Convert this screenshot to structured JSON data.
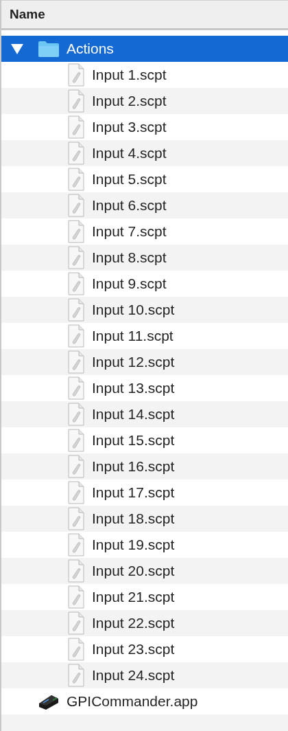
{
  "header": {
    "label": "Name"
  },
  "tree": [
    {
      "name": "Actions",
      "kind": "folder",
      "expanded": true,
      "selected": true,
      "children": [
        {
          "name": "Input 1.scpt",
          "kind": "script",
          "selected": false
        },
        {
          "name": "Input 2.scpt",
          "kind": "script",
          "selected": false
        },
        {
          "name": "Input 3.scpt",
          "kind": "script",
          "selected": false
        },
        {
          "name": "Input 4.scpt",
          "kind": "script",
          "selected": false
        },
        {
          "name": "Input 5.scpt",
          "kind": "script",
          "selected": false
        },
        {
          "name": "Input 6.scpt",
          "kind": "script",
          "selected": false
        },
        {
          "name": "Input 7.scpt",
          "kind": "script",
          "selected": false
        },
        {
          "name": "Input 8.scpt",
          "kind": "script",
          "selected": false
        },
        {
          "name": "Input 9.scpt",
          "kind": "script",
          "selected": false
        },
        {
          "name": "Input 10.scpt",
          "kind": "script",
          "selected": false
        },
        {
          "name": "Input 11.scpt",
          "kind": "script",
          "selected": false
        },
        {
          "name": "Input 12.scpt",
          "kind": "script",
          "selected": false
        },
        {
          "name": "Input 13.scpt",
          "kind": "script",
          "selected": false
        },
        {
          "name": "Input 14.scpt",
          "kind": "script",
          "selected": false
        },
        {
          "name": "Input 15.scpt",
          "kind": "script",
          "selected": false
        },
        {
          "name": "Input 16.scpt",
          "kind": "script",
          "selected": false
        },
        {
          "name": "Input 17.scpt",
          "kind": "script",
          "selected": false
        },
        {
          "name": "Input 18.scpt",
          "kind": "script",
          "selected": false
        },
        {
          "name": "Input 19.scpt",
          "kind": "script",
          "selected": false
        },
        {
          "name": "Input 20.scpt",
          "kind": "script",
          "selected": false
        },
        {
          "name": "Input 21.scpt",
          "kind": "script",
          "selected": false
        },
        {
          "name": "Input 22.scpt",
          "kind": "script",
          "selected": false
        },
        {
          "name": "Input 23.scpt",
          "kind": "script",
          "selected": false
        },
        {
          "name": "Input 24.scpt",
          "kind": "script",
          "selected": false
        }
      ]
    },
    {
      "name": "GPICommander.app",
      "kind": "app",
      "selected": false
    }
  ]
}
